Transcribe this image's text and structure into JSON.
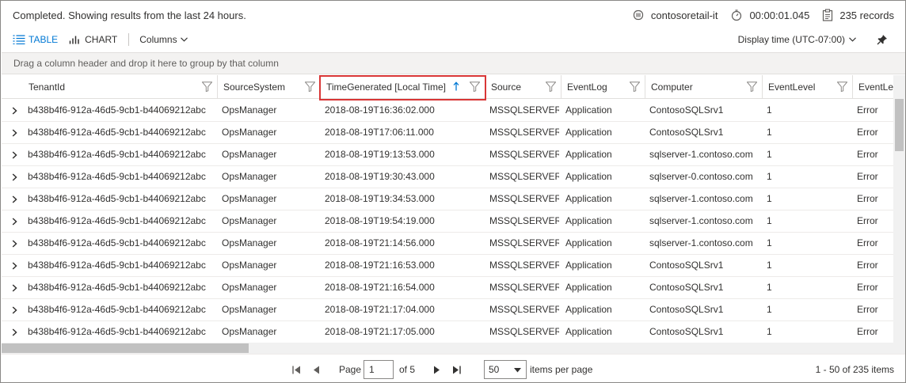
{
  "status": {
    "message": "Completed. Showing results from the last 24 hours.",
    "workspace": "contosoretail-it",
    "duration": "00:00:01.045",
    "records": "235 records"
  },
  "toolbar": {
    "table_label": "TABLE",
    "chart_label": "CHART",
    "columns_label": "Columns",
    "display_time": "Display time (UTC-07:00)"
  },
  "group_panel": "Drag a column header and drop it here to group by that column",
  "columns": [
    "TenantId",
    "SourceSystem",
    "TimeGenerated [Local Time]",
    "Source",
    "EventLog",
    "Computer",
    "EventLevel",
    "EventLev"
  ],
  "rows": [
    [
      "b438b4f6-912a-46d5-9cb1-b44069212abc",
      "OpsManager",
      "2018-08-19T16:36:02.000",
      "MSSQLSERVER",
      "Application",
      "ContosoSQLSrv1",
      "1",
      "Error"
    ],
    [
      "b438b4f6-912a-46d5-9cb1-b44069212abc",
      "OpsManager",
      "2018-08-19T17:06:11.000",
      "MSSQLSERVER",
      "Application",
      "ContosoSQLSrv1",
      "1",
      "Error"
    ],
    [
      "b438b4f6-912a-46d5-9cb1-b44069212abc",
      "OpsManager",
      "2018-08-19T19:13:53.000",
      "MSSQLSERVER",
      "Application",
      "sqlserver-1.contoso.com",
      "1",
      "Error"
    ],
    [
      "b438b4f6-912a-46d5-9cb1-b44069212abc",
      "OpsManager",
      "2018-08-19T19:30:43.000",
      "MSSQLSERVER",
      "Application",
      "sqlserver-0.contoso.com",
      "1",
      "Error"
    ],
    [
      "b438b4f6-912a-46d5-9cb1-b44069212abc",
      "OpsManager",
      "2018-08-19T19:34:53.000",
      "MSSQLSERVER",
      "Application",
      "sqlserver-1.contoso.com",
      "1",
      "Error"
    ],
    [
      "b438b4f6-912a-46d5-9cb1-b44069212abc",
      "OpsManager",
      "2018-08-19T19:54:19.000",
      "MSSQLSERVER",
      "Application",
      "sqlserver-1.contoso.com",
      "1",
      "Error"
    ],
    [
      "b438b4f6-912a-46d5-9cb1-b44069212abc",
      "OpsManager",
      "2018-08-19T21:14:56.000",
      "MSSQLSERVER",
      "Application",
      "sqlserver-1.contoso.com",
      "1",
      "Error"
    ],
    [
      "b438b4f6-912a-46d5-9cb1-b44069212abc",
      "OpsManager",
      "2018-08-19T21:16:53.000",
      "MSSQLSERVER",
      "Application",
      "ContosoSQLSrv1",
      "1",
      "Error"
    ],
    [
      "b438b4f6-912a-46d5-9cb1-b44069212abc",
      "OpsManager",
      "2018-08-19T21:16:54.000",
      "MSSQLSERVER",
      "Application",
      "ContosoSQLSrv1",
      "1",
      "Error"
    ],
    [
      "b438b4f6-912a-46d5-9cb1-b44069212abc",
      "OpsManager",
      "2018-08-19T21:17:04.000",
      "MSSQLSERVER",
      "Application",
      "ContosoSQLSrv1",
      "1",
      "Error"
    ],
    [
      "b438b4f6-912a-46d5-9cb1-b44069212abc",
      "OpsManager",
      "2018-08-19T21:17:05.000",
      "MSSQLSERVER",
      "Application",
      "ContosoSQLSrv1",
      "1",
      "Error"
    ]
  ],
  "pager": {
    "page_label": "Page",
    "page_value": "1",
    "of_label": "of 5",
    "page_size": "50",
    "per_page_label": "items per page",
    "range_label": "1 - 50 of 235 items"
  },
  "colors": {
    "accent": "#0078d4",
    "highlight": "#d93636"
  },
  "icons": {
    "workspace": "workspace-icon",
    "timer": "stopwatch-icon",
    "records": "clipboard-icon",
    "table": "table-icon",
    "chart": "bar-chart-icon",
    "pin": "pin-icon",
    "filter": "filter-icon",
    "sort": "sort-ascending-icon"
  }
}
